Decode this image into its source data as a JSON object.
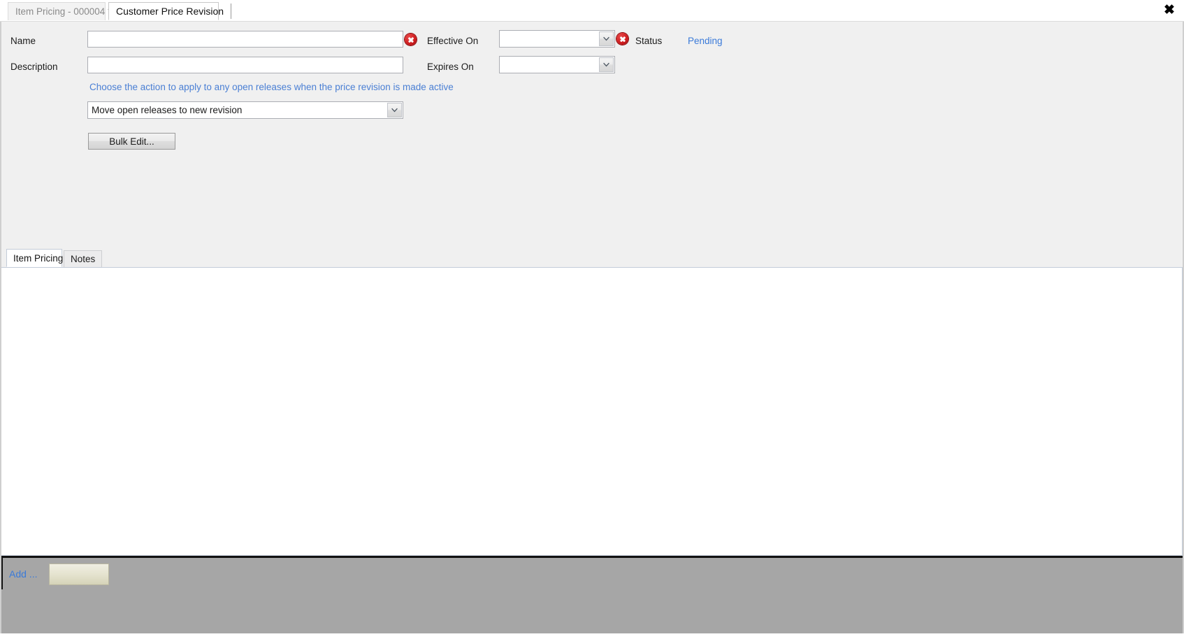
{
  "window": {
    "close_label": "✖"
  },
  "document_tabs": [
    {
      "label": "Item Pricing - 000004 *",
      "active": false
    },
    {
      "label": "Customer Price Revision",
      "active": true
    }
  ],
  "form": {
    "name": {
      "label": "Name",
      "value": "",
      "placeholder": "",
      "has_error": true
    },
    "description": {
      "label": "Description",
      "value": "",
      "placeholder": ""
    },
    "effective_on": {
      "label": "Effective On",
      "value": "",
      "has_error": true
    },
    "expires_on": {
      "label": "Expires On",
      "value": "",
      "has_error": false
    },
    "status": {
      "label": "Status",
      "value": "Pending"
    },
    "action_hint": "Choose the action to apply to any open releases when the price revision is made active",
    "action_select": {
      "value": "Move open releases to new revision",
      "options": [
        "Move open releases to new revision"
      ]
    },
    "bulk_edit_button": "Bulk Edit..."
  },
  "lower_tabs": [
    {
      "label": "Item Pricing",
      "active": true
    },
    {
      "label": "Notes",
      "active": false
    }
  ],
  "grid": {
    "rows": []
  },
  "addbar": {
    "add_label": "Add ..."
  },
  "colors": {
    "panel_bg": "#f0f0f0",
    "link_blue": "#3a7ad9",
    "hint_blue": "#4a7fd4",
    "error_red": "#d01f21",
    "addbar_gray": "#a6a6a6",
    "swatch_cream": "#e4e2cd"
  }
}
